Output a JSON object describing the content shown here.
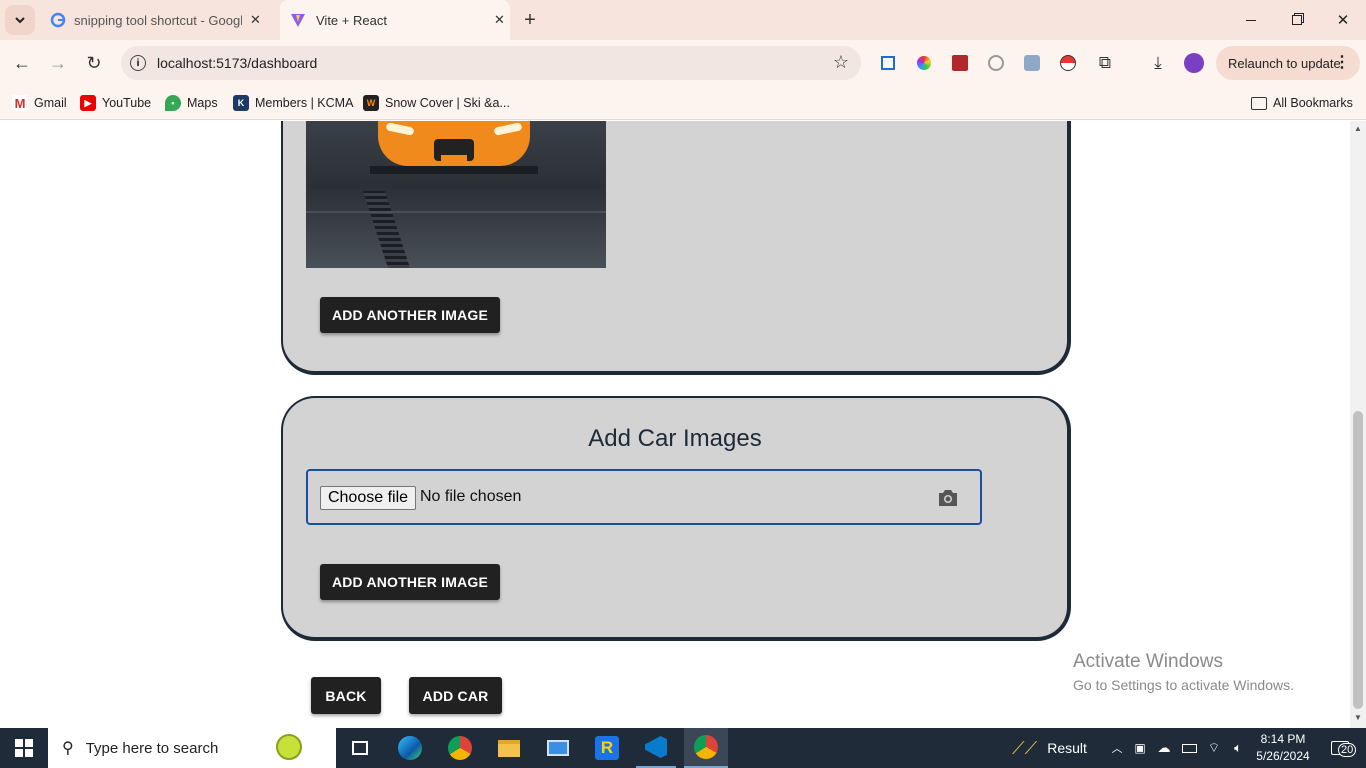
{
  "browser": {
    "tabs": [
      {
        "title": "snipping tool shortcut - Google",
        "active": false
      },
      {
        "title": "Vite + React",
        "active": true
      }
    ],
    "url": "localhost:5173/dashboard",
    "relaunch_label": "Relaunch to update",
    "bookmarks": [
      {
        "label": "Gmail",
        "icon": "gmail-icon"
      },
      {
        "label": "YouTube",
        "icon": "youtube-icon"
      },
      {
        "label": "Maps",
        "icon": "maps-icon"
      },
      {
        "label": "Members | KCMA",
        "icon": "kcma-icon"
      },
      {
        "label": "Snow Cover | Ski &a...",
        "icon": "snowcover-icon"
      }
    ],
    "all_bookmarks_label": "All Bookmarks"
  },
  "page": {
    "section1": {
      "add_image_button": "ADD ANOTHER IMAGE"
    },
    "section2": {
      "heading": "Add Car Images",
      "choose_file_button": "Choose file",
      "file_status": "No file chosen",
      "add_image_button": "ADD ANOTHER IMAGE"
    },
    "back_button": "BACK",
    "add_car_button": "ADD CAR"
  },
  "watermark": {
    "line1": "Activate Windows",
    "line2": "Go to Settings to activate Windows."
  },
  "taskbar": {
    "search_placeholder": "Type here to search",
    "widget_label": "Result",
    "time": "8:14 PM",
    "date": "5/26/2024",
    "notification_count": "20"
  },
  "colors": {
    "card_bg": "#d3d3d3",
    "card_border": "#1e2a38",
    "button_bg": "#212121",
    "focus_border": "#1a4fa0",
    "taskbar_bg": "#1f2b38"
  }
}
